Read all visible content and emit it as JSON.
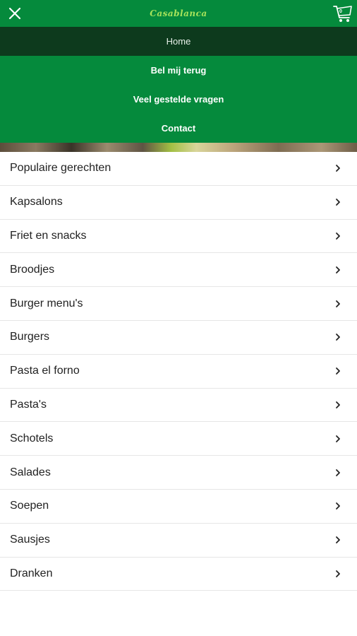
{
  "header": {
    "brand": "Casablanca",
    "cart_count": "0",
    "icons": {
      "close": "close-icon",
      "cart": "cart-icon"
    }
  },
  "nav": {
    "items": [
      {
        "label": "Home",
        "active": true
      },
      {
        "label": "Bel mij terug",
        "active": false
      },
      {
        "label": "Veel gestelde vragen",
        "active": false
      },
      {
        "label": "Contact",
        "active": false
      }
    ]
  },
  "categories": [
    {
      "label": "Populaire gerechten"
    },
    {
      "label": "Kapsalons"
    },
    {
      "label": "Friet en snacks"
    },
    {
      "label": "Broodjes"
    },
    {
      "label": "Burger menu's"
    },
    {
      "label": "Burgers"
    },
    {
      "label": "Pasta el forno"
    },
    {
      "label": "Pasta's"
    },
    {
      "label": "Schotels"
    },
    {
      "label": "Salades"
    },
    {
      "label": "Soepen"
    },
    {
      "label": "Sausjes"
    },
    {
      "label": "Dranken"
    }
  ],
  "colors": {
    "primary_green": "#058a3c",
    "active_nav": "#0d3a1d",
    "brand_text": "#a7e35a"
  }
}
